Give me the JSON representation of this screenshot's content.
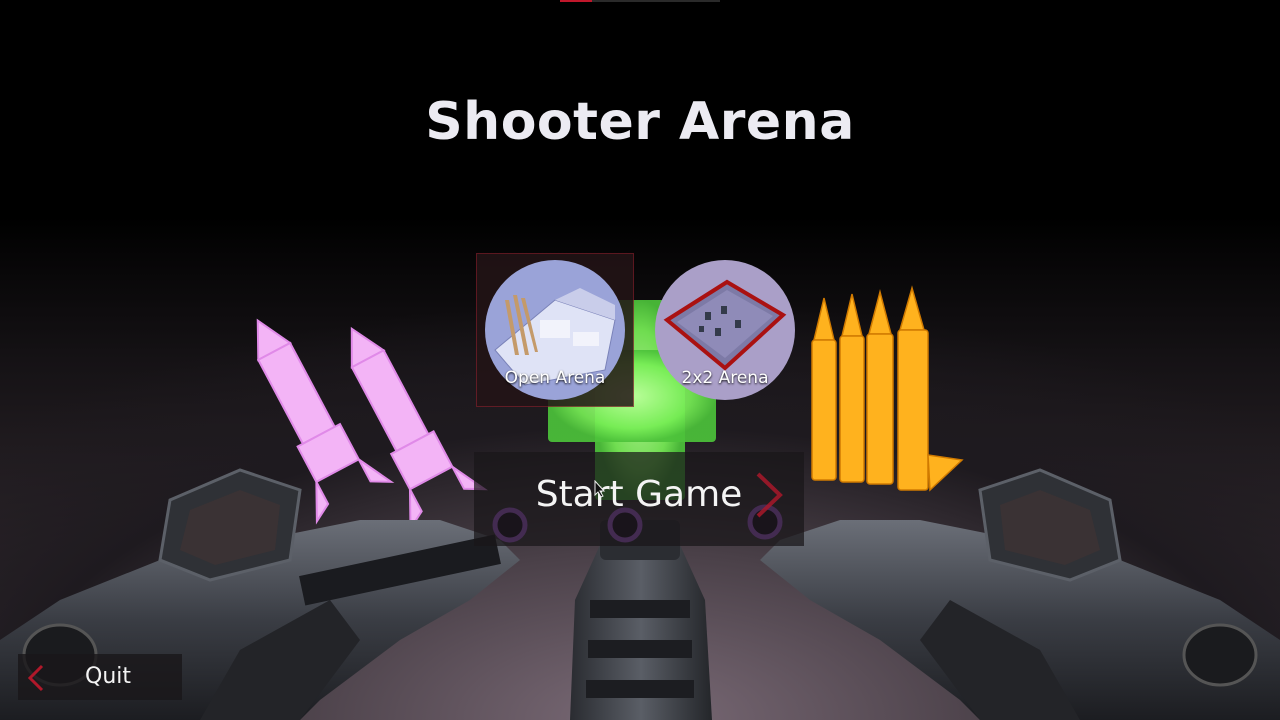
{
  "game": {
    "title": "Shooter Arena"
  },
  "loading_bar": {
    "progress": 0.2,
    "fill_color": "#c0172b"
  },
  "maps": {
    "selected_index": 0,
    "items": [
      {
        "label": "Open Arena",
        "thumbnail_icon": "open-arena-map-icon"
      },
      {
        "label": "2x2 Arena",
        "thumbnail_icon": "2x2-arena-map-icon"
      }
    ]
  },
  "menu": {
    "start_label": "Start Game",
    "quit_label": "Quit"
  },
  "icons": {
    "start_chevron": "chevron-right-icon",
    "quit_chevron": "chevron-left-icon"
  },
  "colors": {
    "accent": "#c0172b",
    "text": "#f4f4f4",
    "rocket_glow": "#f0a0f5",
    "bullet_glow": "#ffb020",
    "health_glow": "#7cff6a"
  }
}
